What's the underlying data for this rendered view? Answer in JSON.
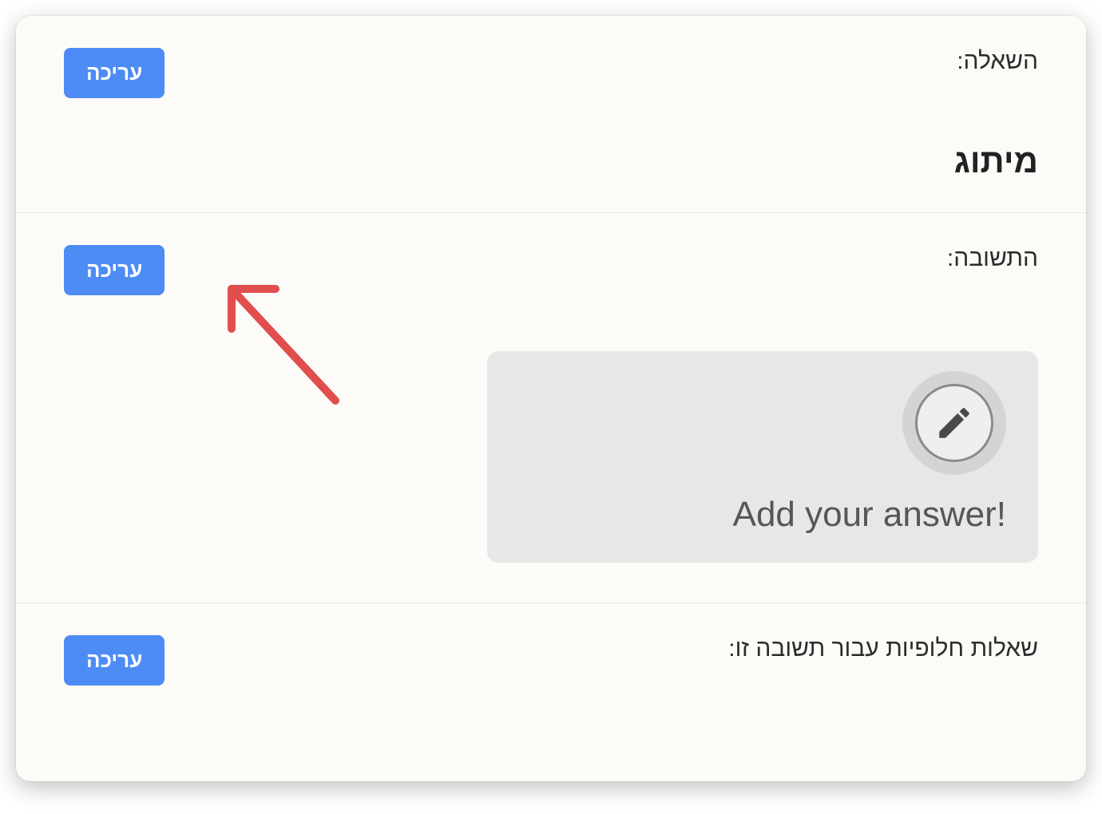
{
  "question": {
    "label": "השאלה:",
    "edit_label": "עריכה",
    "heading": "מיתוג"
  },
  "answer": {
    "label": "התשובה:",
    "edit_label": "עריכה",
    "placeholder_text": "Add your answer!"
  },
  "alternatives": {
    "label": "שאלות חלופיות עבור תשובה זו:",
    "edit_label": "עריכה"
  },
  "colors": {
    "button_bg": "#4d8bf5",
    "card_bg": "#fcfbf7",
    "answer_bg": "#e7e7e7",
    "arrow": "#e04e4e"
  },
  "annotation": {
    "arrow_points_to": "answer-edit-button"
  }
}
